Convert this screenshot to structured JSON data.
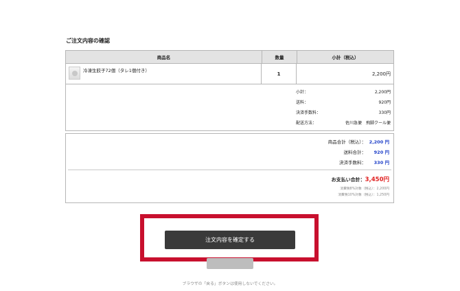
{
  "heading": "ご注文内容の確認",
  "table": {
    "headers": [
      "商品名",
      "数量",
      "小計（税込）"
    ],
    "item": {
      "name": "冷凍生餃子72個（タレ1個付き）",
      "qty": "1",
      "subtotal": "2,200円"
    },
    "details": [
      {
        "label": "小計：",
        "value": "2,200円"
      },
      {
        "label": "送料：",
        "value": "920円"
      },
      {
        "label": "決済手数料：",
        "value": "330円"
      },
      {
        "label": "配送方法：",
        "value": "佐川急便　飛脚クール便"
      }
    ]
  },
  "totals": {
    "rows": [
      {
        "label": "商品合計（税込）：",
        "value": "2,200 円"
      },
      {
        "label": "送料合計：",
        "value": "920 円"
      },
      {
        "label": "決済手数料：",
        "value": "330 円"
      }
    ],
    "grand_label": "お支払い合計：",
    "grand_value": "3,450円",
    "notes": [
      "消費税8%対象（税込）：2,200円",
      "消費税10%対象（税込）：1,250円"
    ]
  },
  "confirm_button": "注文内容を確定する",
  "footnote": "ブラウザの「戻る」ボタンは使用しないでください。",
  "colors": {
    "highlight": "#c8102e",
    "blue": "#1e3fc8",
    "red": "#e02020",
    "button": "#3a3a3a"
  }
}
